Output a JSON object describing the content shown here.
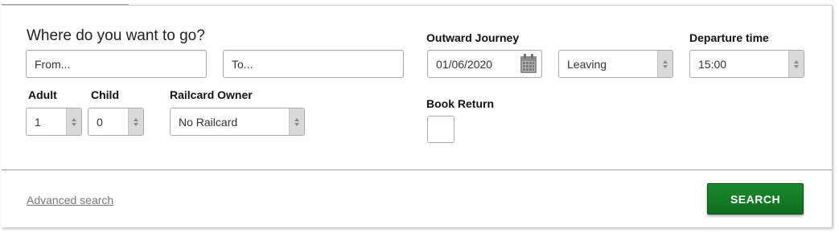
{
  "form": {
    "heading": "Where do you want to go?",
    "from_placeholder": "From...",
    "to_placeholder": "To...",
    "outward_label": "Outward Journey",
    "outward_date": "01/06/2020",
    "leaving_select": "Leaving",
    "departure_label": "Departure time",
    "departure_time": "15:00",
    "adult_label": "Adult",
    "adult_value": "1",
    "child_label": "Child",
    "child_value": "0",
    "railcard_label": "Railcard Owner",
    "railcard_value": "No Railcard",
    "book_return_label": "Book Return",
    "book_return_checked": false
  },
  "footer": {
    "advanced_search": "Advanced search",
    "search_button": "SEARCH"
  },
  "icons": {
    "calendar": "calendar-icon",
    "select_arrows": "up-down-arrows-icon"
  },
  "colors": {
    "search_button_bg": "#137a26",
    "link_text": "#777777",
    "select_arrow_bg": "#d9d9d9"
  }
}
